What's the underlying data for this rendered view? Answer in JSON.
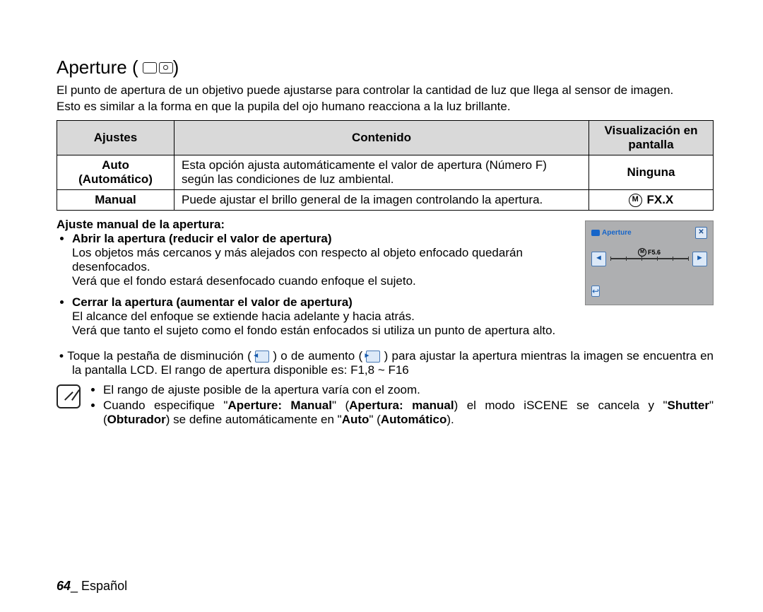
{
  "heading": "Aperture (",
  "heading_close": " )",
  "intro1": "El punto de apertura de un objetivo puede ajustarse para controlar la cantidad de luz que llega al sensor de imagen.",
  "intro2": "Esto es similar a la forma en que la pupila del ojo humano reacciona a la luz brillante.",
  "table": {
    "h1": "Ajustes",
    "h2": "Contenido",
    "h3": "Visualización en pantalla",
    "r1c1a": "Auto",
    "r1c1b": "(Automático)",
    "r1c2": "Esta opción ajusta automáticamente el valor de apertura (Número F) según las condiciones de luz ambiental.",
    "r1c3": "Ninguna",
    "r2c1": "Manual",
    "r2c2": "Puede ajustar el brillo general de la imagen controlando la apertura.",
    "r2c3_icon": "M",
    "r2c3_txt": "FX.X"
  },
  "manual_title": "Ajuste manual de la apertura:",
  "open_title": "Abrir la apertura (reducir el valor de apertura)",
  "open_l1": "Los objetos más cercanos y más alejados con respecto al objeto enfocado quedarán desenfocados.",
  "open_l2": "Verá que el fondo estará desenfocado cuando enfoque el sujeto.",
  "close_title": "Cerrar la apertura (aumentar el valor de apertura)",
  "close_l1": "El alcance del enfoque se extiende hacia adelante y hacia atrás.",
  "close_l2": "Verá que tanto el sujeto como el fondo están enfocados si utiliza un punto de apertura alto.",
  "tab_a": "Toque la pestaña de disminución (",
  "tab_b": ") o de aumento (",
  "tab_c": ") para ajustar la apertura mientras la imagen se encuentra en la pantalla LCD. El rango de apertura disponible es: F1,8 ~ F16",
  "note1": "El rango de ajuste posible de la apertura varía con el zoom.",
  "note2_a": "Cuando especifique \"",
  "note2_b": "Aperture: Manual",
  "note2_c": "\" (",
  "note2_d": "Apertura: manual",
  "note2_e": ") el modo iSCENE se cancela y \"",
  "note2_f": "Shutter",
  "note2_g": "\" (",
  "note2_h": "Obturador",
  "note2_i": ") se define automáticamente en \"",
  "note2_j": "Auto",
  "note2_k": "\" (",
  "note2_l": "Automático",
  "note2_m": ").",
  "figure": {
    "title": "Aperture",
    "value": "F5.6"
  },
  "page_number": "64",
  "page_lang": "_ Español"
}
